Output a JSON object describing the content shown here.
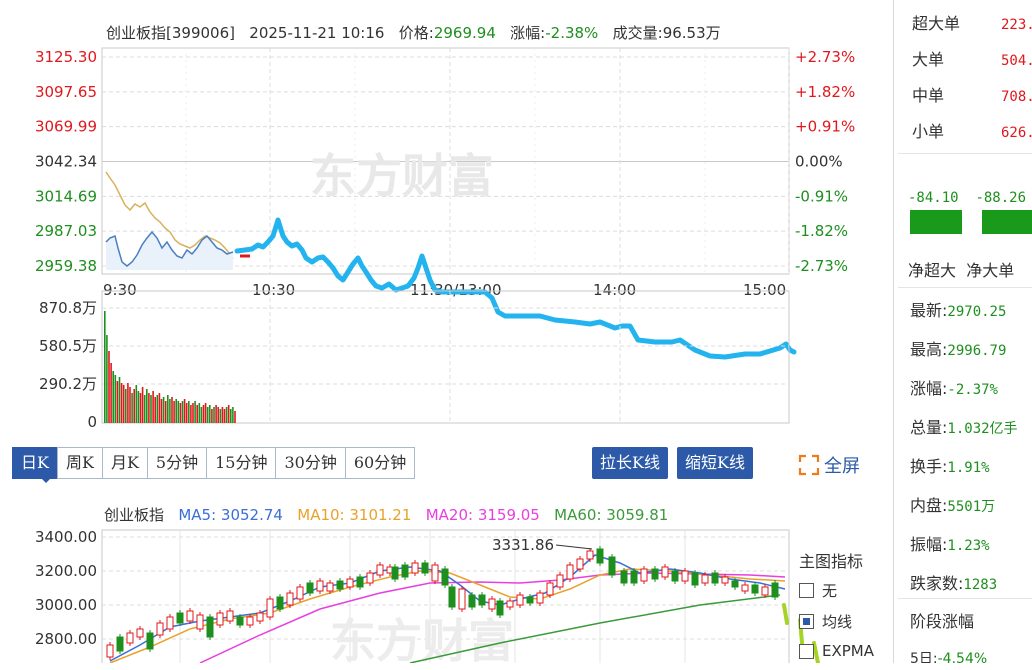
{
  "intraday": {
    "header": {
      "index_name": "创业板指[399006]",
      "datetime": "2025-11-21 10:16",
      "price_label": "价格:",
      "price_value": "2969.94",
      "change_label": "涨幅:",
      "change_value": "-2.38%",
      "volume_label": "成交量:",
      "volume_value": "96.53万"
    },
    "price_ticks": [
      "3125.30",
      "3097.65",
      "3069.99",
      "3042.34",
      "3014.69",
      "2987.03",
      "2959.38"
    ],
    "pct_ticks": [
      "+2.73%",
      "+1.82%",
      "+0.91%",
      "0.00%",
      "-0.91%",
      "-1.82%",
      "-2.73%"
    ],
    "time_ticks": [
      "9:30",
      "10:30",
      "11:30/13:00",
      "14:00",
      "15:00"
    ],
    "volume_ticks": [
      "870.8万",
      "580.5万",
      "290.2万",
      "0"
    ],
    "watermark": "东方财富",
    "colors": {
      "price_line": "#4a7fc1",
      "avg_line": "#d8b15a",
      "projection": "#23b4ef",
      "up": "#e0181c",
      "down": "#1e8f1e"
    }
  },
  "kline": {
    "tabs": [
      "日K",
      "周K",
      "月K",
      "5分钟",
      "15分钟",
      "30分钟",
      "60分钟"
    ],
    "active_tab": "日K",
    "stretch_button": "拉长K线",
    "shrink_button": "缩短K线",
    "fullscreen_label": "全屏",
    "legend": {
      "name": "创业板指",
      "ma5": "MA5: 3052.74",
      "ma10": "MA10: 3101.21",
      "ma20": "MA20: 3159.05",
      "ma60": "MA60: 3059.81"
    },
    "price_ticks": [
      "3400.00",
      "3200.00",
      "3000.00",
      "2800.00"
    ],
    "high_annotation": "3331.86",
    "indicator_panel": {
      "title": "主图指标",
      "options": [
        {
          "label": "无",
          "checked": false
        },
        {
          "label": "均线",
          "checked": true
        },
        {
          "label": "EXPMA",
          "checked": false
        }
      ]
    },
    "colors": {
      "ma5": "#3b6fd6",
      "ma10": "#e8a22c",
      "ma20": "#e83fe0",
      "ma60": "#3a9a3a"
    }
  },
  "side": {
    "order_flow": [
      {
        "label": "超大单",
        "value": "223."
      },
      {
        "label": "大单",
        "value": "504."
      },
      {
        "label": "中单",
        "value": "708."
      },
      {
        "label": "小单",
        "value": "626."
      }
    ],
    "net_values": [
      "-84.10",
      "-88.26"
    ],
    "net_labels": [
      "净超大",
      "净大单"
    ],
    "stats": [
      {
        "label": "最新:",
        "value": "2970.25"
      },
      {
        "label": "最高:",
        "value": "2996.79"
      },
      {
        "label": "涨幅:",
        "value": "-2.37%"
      },
      {
        "label": "总量:",
        "value": "1.032亿手"
      },
      {
        "label": "换手:",
        "value": "1.91%"
      },
      {
        "label": "内盘:",
        "value": "5501万"
      },
      {
        "label": "振幅:",
        "value": "1.23%"
      },
      {
        "label": "跌家数:",
        "value": "1283"
      }
    ],
    "period_title": "阶段涨幅",
    "period_first": {
      "label": "5日:",
      "value": "-4.54%"
    }
  }
}
